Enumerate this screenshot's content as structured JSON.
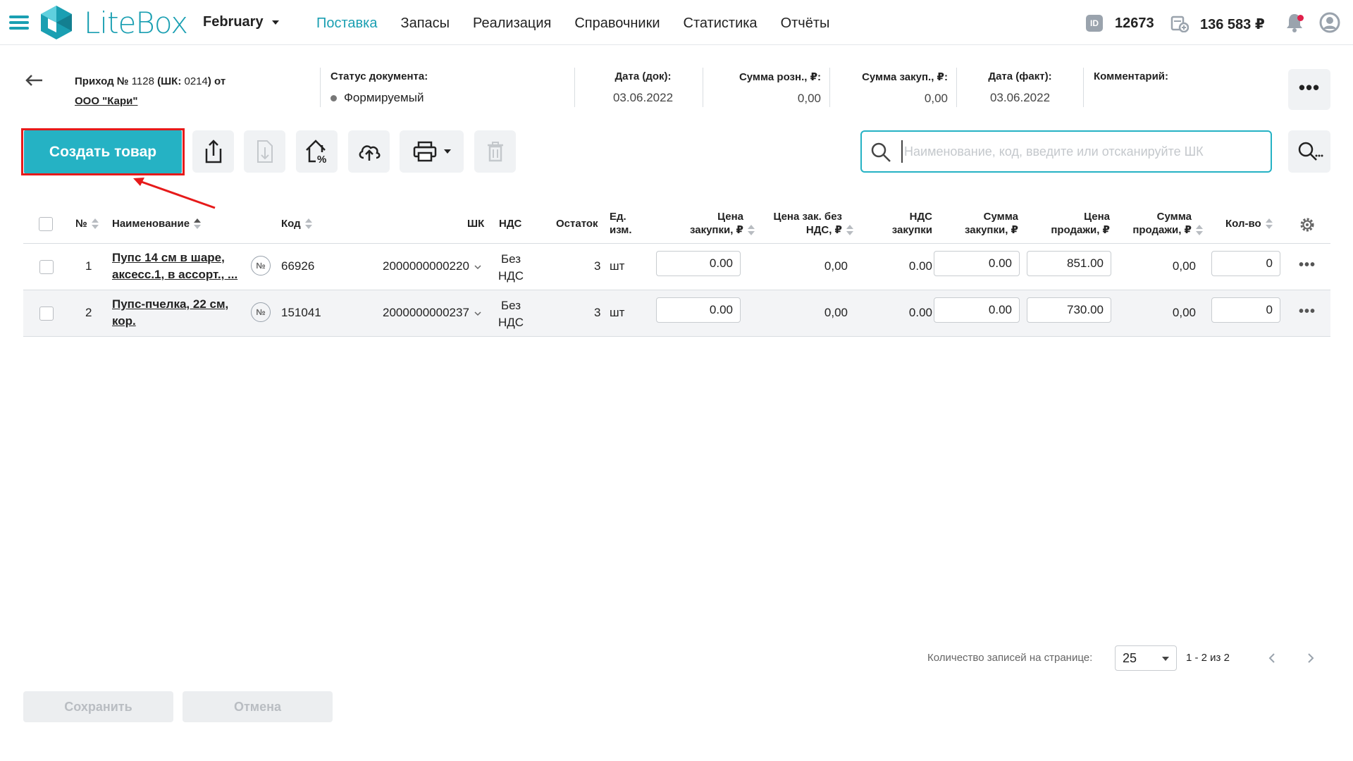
{
  "app": {
    "brand": "LiteBox",
    "store": "February"
  },
  "nav": {
    "items": [
      {
        "label": "Поставка",
        "active": true
      },
      {
        "label": "Запасы",
        "active": false
      },
      {
        "label": "Реализация",
        "active": false
      },
      {
        "label": "Справочники",
        "active": false
      },
      {
        "label": "Статистика",
        "active": false
      },
      {
        "label": "Отчёты",
        "active": false
      }
    ]
  },
  "topbar": {
    "id_badge": "ID",
    "id_value": "12673",
    "cash_value": "136 583 ₽",
    "notification_unread": true
  },
  "document": {
    "title_prefix": "Приход №",
    "title_number": " 1128 ",
    "title_code": "(ШК: ",
    "title_code_value": "0214",
    "title_suffix": ") от",
    "supplier": "ООО \"Кари\"",
    "status_label": "Статус документа:",
    "status_value": "Формируемый",
    "date_doc_label": "Дата (док):",
    "date_doc_value": "03.06.2022",
    "retail_sum_label": "Сумма розн., ₽:",
    "retail_sum_value": "0,00",
    "purchase_sum_label": "Сумма закуп., ₽:",
    "purchase_sum_value": "0,00",
    "date_fact_label": "Дата (факт):",
    "date_fact_value": "03.06.2022",
    "comment_label": "Комментарий:",
    "comment_value": ""
  },
  "toolbar": {
    "create_label": "Создать товар",
    "search_placeholder": "Наименование, код, введите или отсканируйте ШК"
  },
  "table": {
    "headers": {
      "num": "№",
      "name": "Наименование",
      "code": "Код",
      "barcode": "ШК",
      "vat": "НДС",
      "stock": "Остаток",
      "unit_1": "Ед.",
      "unit_2": "изм.",
      "purchase_price_1": "Цена",
      "purchase_price_2": "закупки, ₽",
      "purchase_novat_1": "Цена зак. без",
      "purchase_novat_2": "НДС, ₽",
      "vat_purchase_1": "НДС",
      "vat_purchase_2": "закупки",
      "purchase_sum_1": "Сумма",
      "purchase_sum_2": "закупки, ₽",
      "sale_price_1": "Цена",
      "sale_price_2": "продажи, ₽",
      "sale_sum_1": "Сумма",
      "sale_sum_2": "продажи, ₽",
      "qty": "Кол-во"
    },
    "rows": [
      {
        "num": "1",
        "name_1": "Пупс 14 см в шаре,",
        "name_2": "аксесс.1, в ассорт., ...",
        "num_badge": "№",
        "code": "66926",
        "barcode": "2000000000220",
        "vat_1": "Без",
        "vat_2": "НДС",
        "stock": "3",
        "unit": "шт",
        "purchase_price": "0.00",
        "purchase_novat": "0,00",
        "vat_purchase": "0.00",
        "purchase_sum": "0.00",
        "sale_price": "851.00",
        "sale_sum": "0,00",
        "qty": "0"
      },
      {
        "num": "2",
        "name_1": "Пупс-пчелка, 22 см,",
        "name_2": "кор.",
        "num_badge": "№",
        "code": "151041",
        "barcode": "2000000000237",
        "vat_1": "Без",
        "vat_2": "НДС",
        "stock": "3",
        "unit": "шт",
        "purchase_price": "0.00",
        "purchase_novat": "0,00",
        "vat_purchase": "0.00",
        "purchase_sum": "0.00",
        "sale_price": "730.00",
        "sale_sum": "0,00",
        "qty": "0"
      }
    ]
  },
  "pagination": {
    "per_page_label": "Количество записей на странице:",
    "per_page_value": "25",
    "range": "1 - 2 из 2"
  },
  "footer": {
    "save_label": "Сохранить",
    "cancel_label": "Отмена"
  },
  "colors": {
    "accent": "#25b2c4",
    "brand": "#1a9fb2",
    "highlight": "#e61a1a"
  }
}
